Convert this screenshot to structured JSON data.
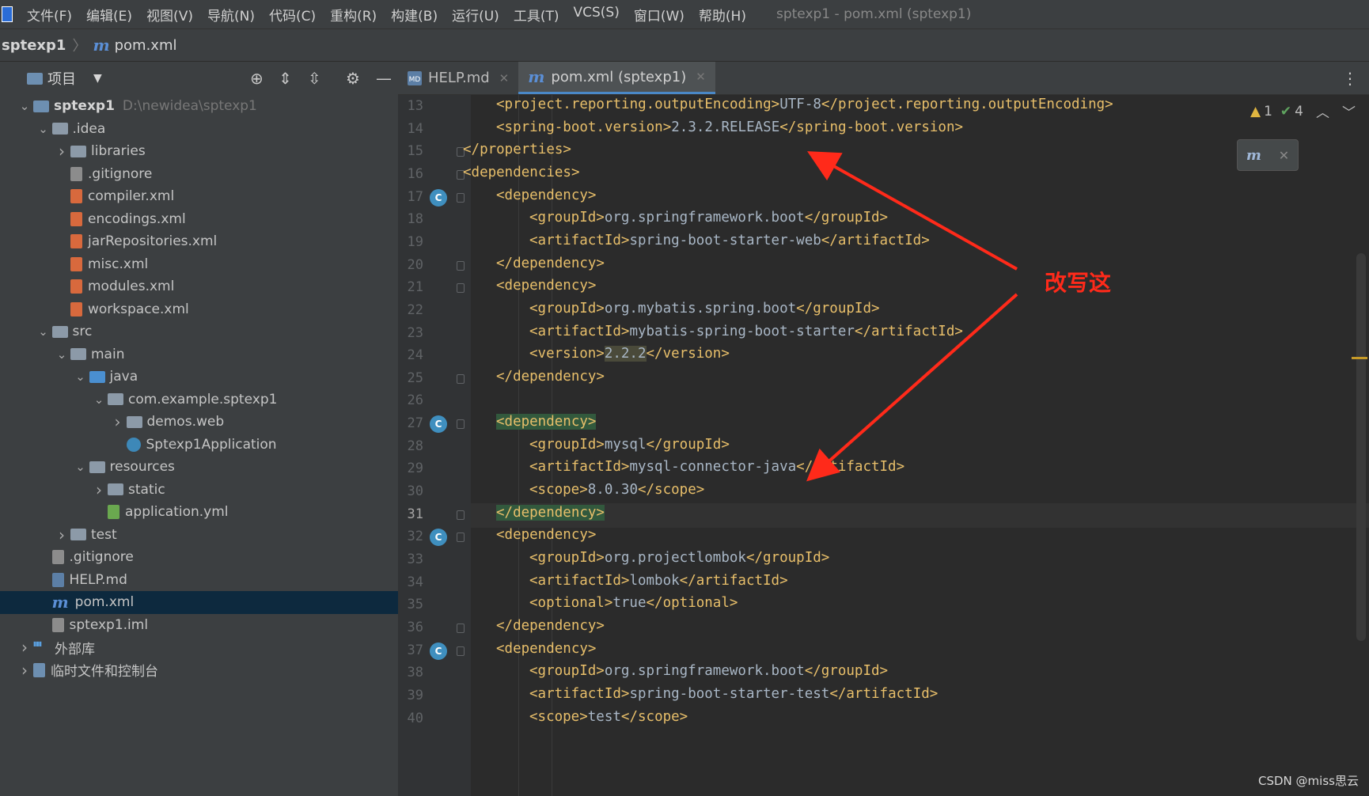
{
  "menubar": {
    "items": [
      "文件(F)",
      "编辑(E)",
      "视图(V)",
      "导航(N)",
      "代码(C)",
      "重构(R)",
      "构建(B)",
      "运行(U)",
      "工具(T)",
      "VCS(S)",
      "窗口(W)",
      "帮助(H)"
    ],
    "window_title": "sptexp1 - pom.xml (sptexp1)"
  },
  "breadcrumb": {
    "project": "sptexp1",
    "file": "pom.xml",
    "file_icon": "m"
  },
  "project_panel": {
    "title": "项目",
    "tree": [
      {
        "label": "sptexp1",
        "path": "D:\\newidea\\sptexp1",
        "level": 0,
        "arrow": "down",
        "icon": "module-folder",
        "bold": true
      },
      {
        "label": ".idea",
        "level": 1,
        "arrow": "down",
        "icon": "folder"
      },
      {
        "label": "libraries",
        "level": 2,
        "arrow": "right",
        "icon": "folder"
      },
      {
        "label": ".gitignore",
        "level": 2,
        "arrow": "",
        "icon": "git"
      },
      {
        "label": "compiler.xml",
        "level": 2,
        "arrow": "",
        "icon": "xml"
      },
      {
        "label": "encodings.xml",
        "level": 2,
        "arrow": "",
        "icon": "xml"
      },
      {
        "label": "jarRepositories.xml",
        "level": 2,
        "arrow": "",
        "icon": "xml"
      },
      {
        "label": "misc.xml",
        "level": 2,
        "arrow": "",
        "icon": "xml"
      },
      {
        "label": "modules.xml",
        "level": 2,
        "arrow": "",
        "icon": "xml"
      },
      {
        "label": "workspace.xml",
        "level": 2,
        "arrow": "",
        "icon": "xml"
      },
      {
        "label": "src",
        "level": 1,
        "arrow": "down",
        "icon": "folder"
      },
      {
        "label": "main",
        "level": 2,
        "arrow": "down",
        "icon": "folder"
      },
      {
        "label": "java",
        "level": 3,
        "arrow": "down",
        "icon": "folder-blue"
      },
      {
        "label": "com.example.sptexp1",
        "level": 4,
        "arrow": "down",
        "icon": "package"
      },
      {
        "label": "demos.web",
        "level": 5,
        "arrow": "right",
        "icon": "package"
      },
      {
        "label": "Sptexp1Application",
        "level": 5,
        "arrow": "",
        "icon": "java"
      },
      {
        "label": "resources",
        "level": 3,
        "arrow": "down",
        "icon": "folder-res"
      },
      {
        "label": "static",
        "level": 4,
        "arrow": "right",
        "icon": "folder"
      },
      {
        "label": "application.yml",
        "level": 4,
        "arrow": "",
        "icon": "yml"
      },
      {
        "label": "test",
        "level": 2,
        "arrow": "right",
        "icon": "folder"
      },
      {
        "label": ".gitignore",
        "level": 1,
        "arrow": "",
        "icon": "git"
      },
      {
        "label": "HELP.md",
        "level": 1,
        "arrow": "",
        "icon": "md"
      },
      {
        "label": "pom.xml",
        "level": 1,
        "arrow": "",
        "icon": "maven",
        "selected": true
      },
      {
        "label": "sptexp1.iml",
        "level": 1,
        "arrow": "",
        "icon": "iml"
      },
      {
        "label": "外部库",
        "level": 0,
        "arrow": "right",
        "icon": "lib"
      },
      {
        "label": "临时文件和控制台",
        "level": 0,
        "arrow": "right",
        "icon": "scratch"
      }
    ]
  },
  "tabs": [
    {
      "label": "HELP.md",
      "icon": "MD",
      "active": false
    },
    {
      "label": "pom.xml (sptexp1)",
      "icon": "m",
      "active": true
    }
  ],
  "inspections": {
    "warnings": "1",
    "ok": "4"
  },
  "maven_popup": {
    "icon": "m"
  },
  "editor": {
    "current_line": 31,
    "lines": [
      {
        "n": 13,
        "indent": 2,
        "code": "<project.reporting.outputEncoding>UTF-8</project.reporting.outputEncoding>"
      },
      {
        "n": 14,
        "indent": 2,
        "code": "<spring-boot.version>2.3.2.RELEASE</spring-boot.version>"
      },
      {
        "n": 15,
        "indent": 1,
        "code": "</properties>",
        "fold": true
      },
      {
        "n": 16,
        "indent": 1,
        "code": "<dependencies>",
        "fold": true
      },
      {
        "n": 17,
        "indent": 2,
        "code": "<dependency>",
        "fold": true,
        "run": true
      },
      {
        "n": 18,
        "indent": 3,
        "code": "<groupId>org.springframework.boot</groupId>"
      },
      {
        "n": 19,
        "indent": 3,
        "code": "<artifactId>spring-boot-starter-web</artifactId>"
      },
      {
        "n": 20,
        "indent": 2,
        "code": "</dependency>",
        "fold": true
      },
      {
        "n": 21,
        "indent": 2,
        "code": "<dependency>",
        "fold": true
      },
      {
        "n": 22,
        "indent": 3,
        "code": "<groupId>org.mybatis.spring.boot</groupId>"
      },
      {
        "n": 23,
        "indent": 3,
        "code": "<artifactId>mybatis-spring-boot-starter</artifactId>"
      },
      {
        "n": 24,
        "indent": 3,
        "code": "<version>2.2.2</version>"
      },
      {
        "n": 25,
        "indent": 2,
        "code": "</dependency>",
        "fold": true
      },
      {
        "n": 26,
        "indent": 0,
        "code": ""
      },
      {
        "n": 27,
        "indent": 2,
        "code": "<dependency>",
        "fold": true,
        "run": true,
        "match": true
      },
      {
        "n": 28,
        "indent": 3,
        "code": "<groupId>mysql</groupId>"
      },
      {
        "n": 29,
        "indent": 3,
        "code": "<artifactId>mysql-connector-java</artifactId>"
      },
      {
        "n": 30,
        "indent": 3,
        "code": "<scope>8.0.30</scope>"
      },
      {
        "n": 31,
        "indent": 2,
        "code": "</dependency>",
        "fold": true,
        "bulb": true,
        "match": true
      },
      {
        "n": 32,
        "indent": 2,
        "code": "<dependency>",
        "fold": true,
        "run": true
      },
      {
        "n": 33,
        "indent": 3,
        "code": "<groupId>org.projectlombok</groupId>"
      },
      {
        "n": 34,
        "indent": 3,
        "code": "<artifactId>lombok</artifactId>"
      },
      {
        "n": 35,
        "indent": 3,
        "code": "<optional>true</optional>"
      },
      {
        "n": 36,
        "indent": 2,
        "code": "</dependency>",
        "fold": true
      },
      {
        "n": 37,
        "indent": 2,
        "code": "<dependency>",
        "fold": true,
        "run": true
      },
      {
        "n": 38,
        "indent": 3,
        "code": "<groupId>org.springframework.boot</groupId>"
      },
      {
        "n": 39,
        "indent": 3,
        "code": "<artifactId>spring-boot-starter-test</artifactId>"
      },
      {
        "n": 40,
        "indent": 3,
        "code": "<scope>test</scope>"
      }
    ]
  },
  "annotation": {
    "text": "改写这",
    "color": "#ff2a1a"
  },
  "watermark": "CSDN @miss思云"
}
